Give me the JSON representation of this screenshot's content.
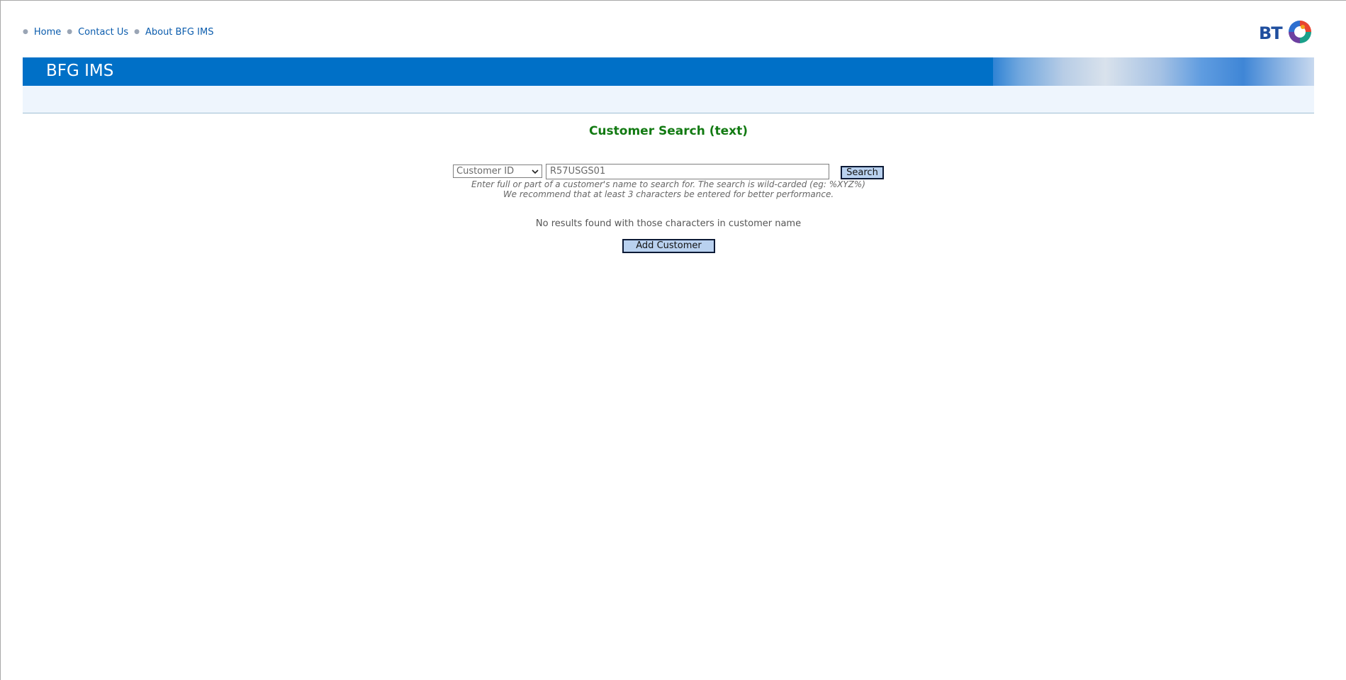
{
  "nav": {
    "items": [
      {
        "label": "Home"
      },
      {
        "label": "Contact Us"
      },
      {
        "label": "About BFG IMS"
      }
    ]
  },
  "logo": {
    "text": "BT",
    "icon": "bt-piper-icon"
  },
  "banner": {
    "title": "BFG IMS"
  },
  "page": {
    "title": "Customer Search (text)"
  },
  "search": {
    "field_selected": "Customer ID",
    "query_value": "R57USGS01",
    "button_label": "Search",
    "hint_line1": "Enter full or part of a customer's name to search for. The search is wild-carded (eg: %XYZ%)",
    "hint_line2": "We recommend that at least 3 characters be entered for better performance."
  },
  "results": {
    "message": "No results found with those characters in customer name"
  },
  "actions": {
    "add_customer_label": "Add Customer"
  },
  "colors": {
    "banner_blue": "#0070c7",
    "title_green": "#127a12",
    "link_blue": "#0b5cad",
    "button_fill": "#b9d1ef"
  }
}
